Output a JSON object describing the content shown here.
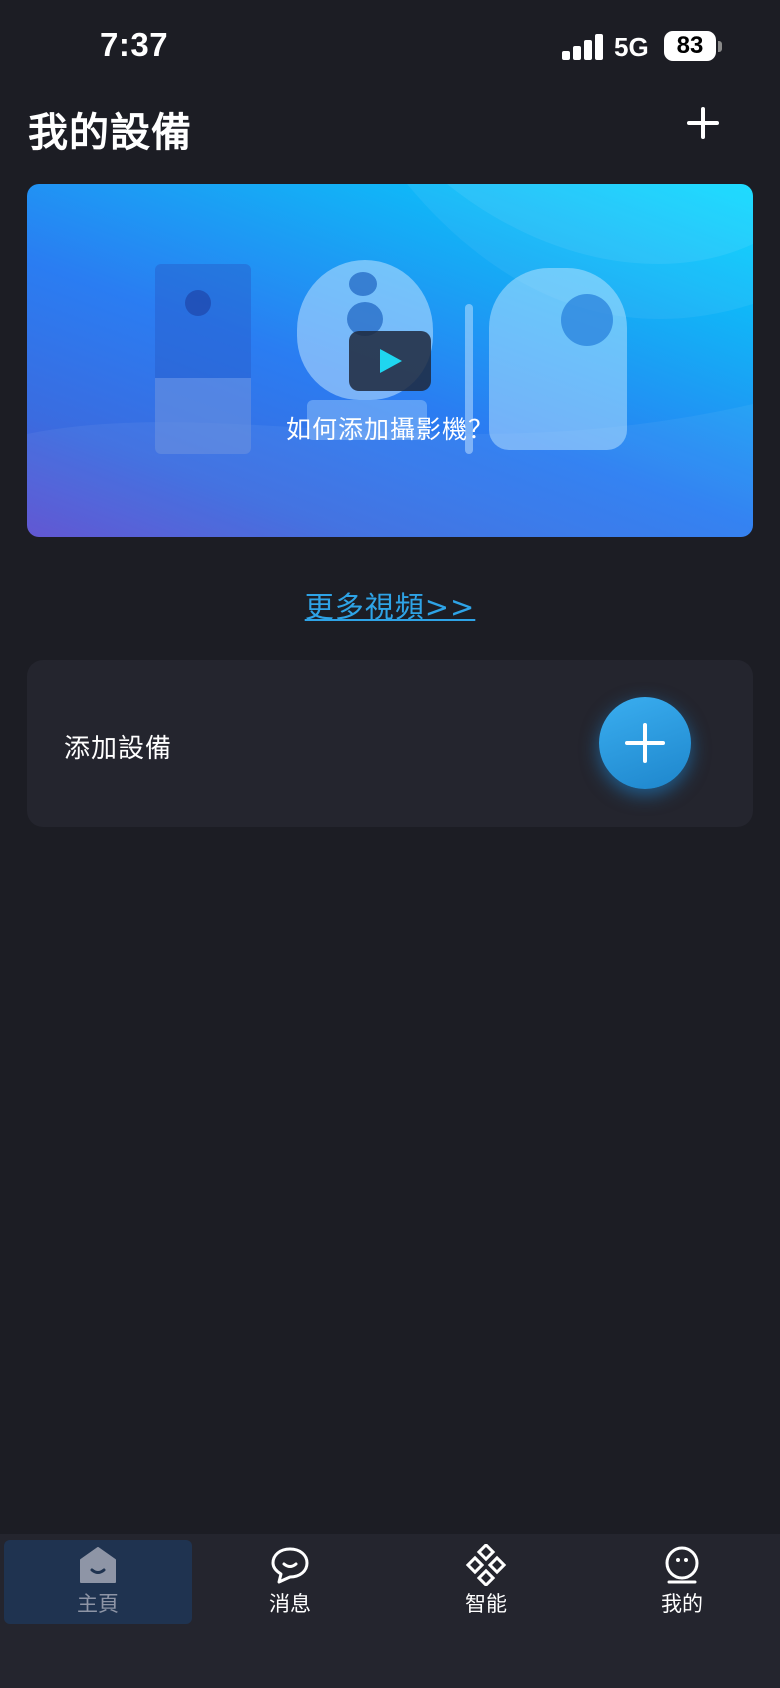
{
  "status_bar": {
    "time": "7:37",
    "network": "5G",
    "battery": "83"
  },
  "header": {
    "title": "我的設備",
    "add_icon": "plus-icon"
  },
  "banner": {
    "caption": "如何添加攝影機？",
    "play_icon": "play-icon",
    "gradient_start": "#00d8ff",
    "gradient_end": "#5a4fd0"
  },
  "more_videos": {
    "label": "更多視頻>>",
    "color": "#2ea3e6"
  },
  "add_device": {
    "label": "添加設備",
    "button_icon": "plus-icon",
    "accent": "#2a9ae0"
  },
  "tabs": [
    {
      "label": "主頁",
      "icon": "home-icon",
      "active": true
    },
    {
      "label": "消息",
      "icon": "message-icon",
      "active": false
    },
    {
      "label": "智能",
      "icon": "smart-icon",
      "active": false
    },
    {
      "label": "我的",
      "icon": "profile-icon",
      "active": false
    }
  ],
  "colors": {
    "background": "#1c1d24",
    "card": "#24252e",
    "active_tab": "#1f3350"
  }
}
